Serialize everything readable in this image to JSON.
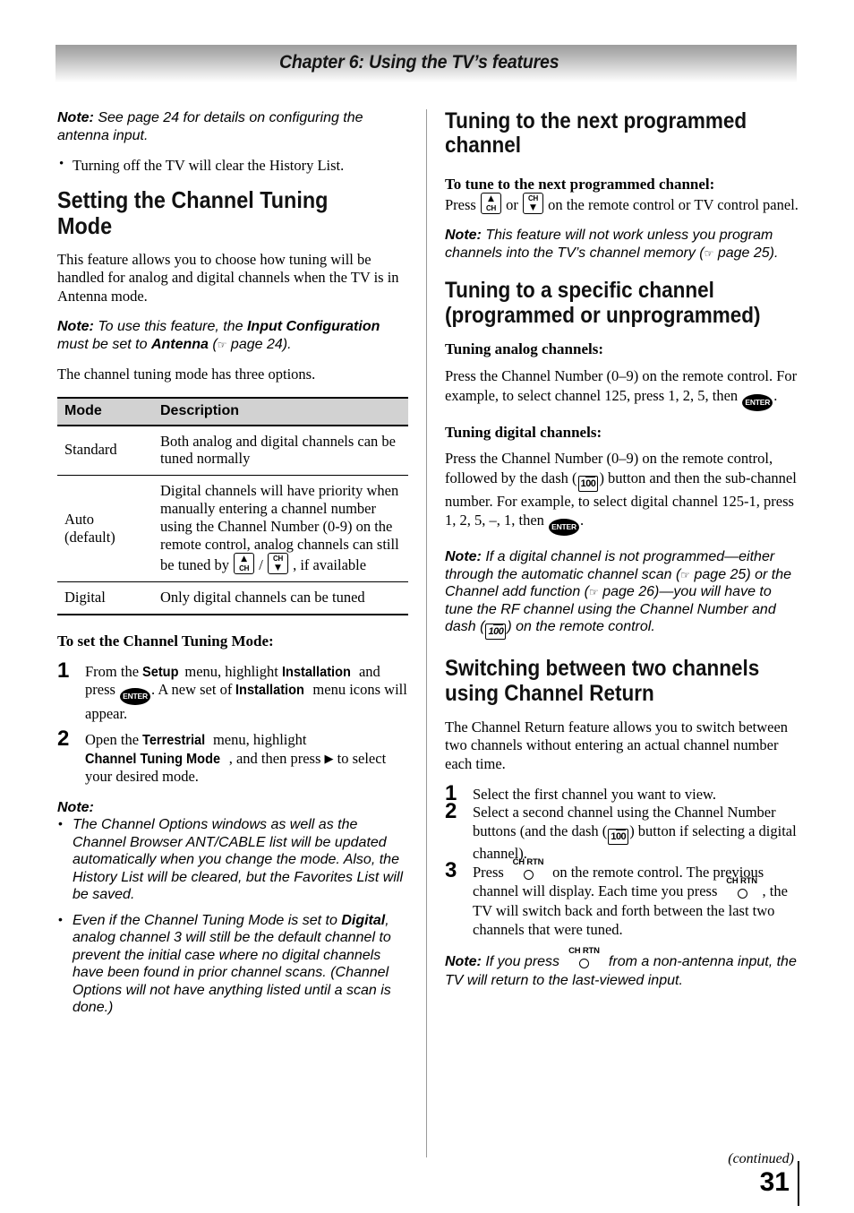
{
  "header": {
    "chapter_title": "Chapter 6: Using the TV’s features"
  },
  "left_column": {
    "note_antenna": {
      "label": "Note:",
      "text": " See page 24 for details on configuring the antenna input."
    },
    "bullet_history": "Turning off the TV will clear the History List.",
    "heading_setting_mode": "Setting the Channel Tuning Mode",
    "para_feature": "This feature allows you to choose how tuning will be handled for analog and digital channels when the TV is in Antenna mode.",
    "note_input_config": {
      "label": "Note:",
      "t1": " To use this feature, the ",
      "b1": "Input Configuration",
      "t2": " must be set to ",
      "b2": "Antenna",
      "t3": " (",
      "icon": "pointing-hand-icon",
      "t4": " page 24)."
    },
    "para_three_options": "The channel tuning mode has three options.",
    "table": {
      "columns": [
        "Mode",
        "Description"
      ],
      "rows": [
        {
          "mode": "Standard",
          "description": "Both analog and digital channels can be tuned normally"
        },
        {
          "mode": "Auto\n(default)",
          "mode_line1": "Auto",
          "mode_line2": "(default)",
          "desc_part1": "Digital channels will have priority when manually entering a channel number using the Channel Number (0-9) on the remote control, analog channels can still be tuned by ",
          "desc_part2": " / ",
          "desc_part3": " , if available"
        },
        {
          "mode": "Digital",
          "description": "Only digital channels can be tuned"
        }
      ]
    },
    "heading_to_set": "To set the Channel Tuning Mode:",
    "steps": [
      {
        "num": "1",
        "t1": "From the ",
        "b1": "Setup",
        "t2": " menu, highlight ",
        "b2": "Installation",
        "t3": " and press ",
        "icon": "enter-button-icon",
        "icon_label": "ENTER",
        "t4": ". A new set of ",
        "b3": "Installation",
        "t5": " menu icons will appear."
      },
      {
        "num": "2",
        "t1": "Open the ",
        "b1": "Terrestrial",
        "t2": " menu, highlight ",
        "b2": "Channel Tuning Mode",
        "t3": ", and then press ",
        "icon": "right-arrow-icon",
        "t4": " to select your desired mode."
      }
    ],
    "note_label": "Note:",
    "note_bullets": [
      {
        "text": "The Channel Options windows as well as the Channel Browser ANT/CABLE list will be updated automatically when you change the mode. Also, the History List will be cleared, but the Favorites List will be saved."
      },
      {
        "t1": "Even if the Channel Tuning Mode is set to ",
        "b1": "Digital",
        "t2": ", analog channel 3 will still be the default channel to prevent the initial case where no digital channels have been found in prior channel scans. (Channel Options will not have anything listed until a scan is done.)"
      }
    ]
  },
  "right_column": {
    "heading_next_programmed": "Tuning to the next programmed channel",
    "subhead_to_tune": "To tune to the next programmed channel:",
    "press_t1": "Press ",
    "press_t2": " or ",
    "press_t3": " on the remote control or TV control panel.",
    "note_memory": {
      "label": "Note:",
      "t1": " This feature will not work unless you program channels into the TV’s channel memory (",
      "icon": "pointing-hand-icon",
      "t2": " page 25)."
    },
    "heading_specific_channel": "Tuning to a specific channel (programmed or unprogrammed)",
    "subhead_analog": "Tuning analog channels:",
    "analog_t1": "Press the Channel Number (0–9) on the remote control. For example, to select channel 125, press 1, 2, 5, then ",
    "analog_icon": "enter-button-icon",
    "analog_icon_label": "ENTER",
    "analog_t2": ".",
    "subhead_digital": "Tuning digital channels:",
    "digital_t1": "Press the Channel Number (0–9) on the remote control, followed by the dash (",
    "digital_icon_100": "dash-100-button-icon",
    "digital_t2": ") button and then the sub-channel number. For example, to select digital channel 125-1, press 1, 2, 5, –, 1, then ",
    "digital_icon_enter": "enter-button-icon",
    "digital_t3": ".",
    "note_not_programmed": {
      "label": "Note:",
      "t1": " If a digital channel is not programmed—either through the automatic channel scan (",
      "icon1": "pointing-hand-icon",
      "t2": " page 25) or the Channel add function (",
      "icon2": "pointing-hand-icon",
      "t3": " page 26)—you will have to tune the RF channel using the Channel Number and dash (",
      "icon3": "dash-100-button-icon",
      "t4": ") on the remote control."
    },
    "heading_channel_return": "Switching between two channels using Channel Return",
    "para_return": "The Channel Return feature allows you to switch between two channels without entering an actual channel number each time.",
    "steps": [
      {
        "num": "1",
        "text": "Select the first channel you want to view."
      },
      {
        "num": "2",
        "t1": "Select a second channel using the Channel Number buttons (and the dash (",
        "icon": "dash-100-button-icon",
        "t2": ") button if selecting a digital channel)."
      },
      {
        "num": "3",
        "t1": "Press ",
        "icon1": "ch-rtn-button-icon",
        "icon_label": "CH RTN",
        "t2": " on the remote control. The previous channel will display. Each time you press ",
        "icon2": "ch-rtn-button-icon",
        "t3": ", the TV will switch back and forth between the last two channels that were tuned."
      }
    ],
    "note_non_antenna": {
      "label": "Note:",
      "t1": " If you press ",
      "icon": "ch-rtn-button-icon",
      "icon_label": "CH RTN",
      "t2": " from a non-antenna input, the TV will return to the last-viewed input."
    }
  },
  "footer": {
    "continued": "(continued)",
    "page_number": "31"
  },
  "icon_glyphs": {
    "pointing_hand": "☞",
    "right_arrow": "▶",
    "up_triangle": "▲",
    "down_triangle": "▼",
    "ch_label": "CH",
    "hundred_label": "1",
    "hundred_over": "00"
  },
  "colors": {
    "header_bar_top": "#9d9d9d",
    "header_bar_bottom": "#ffffff",
    "table_header_bg": "#d2d2d2",
    "divider": "#9a9a9a",
    "text": "#000000"
  }
}
